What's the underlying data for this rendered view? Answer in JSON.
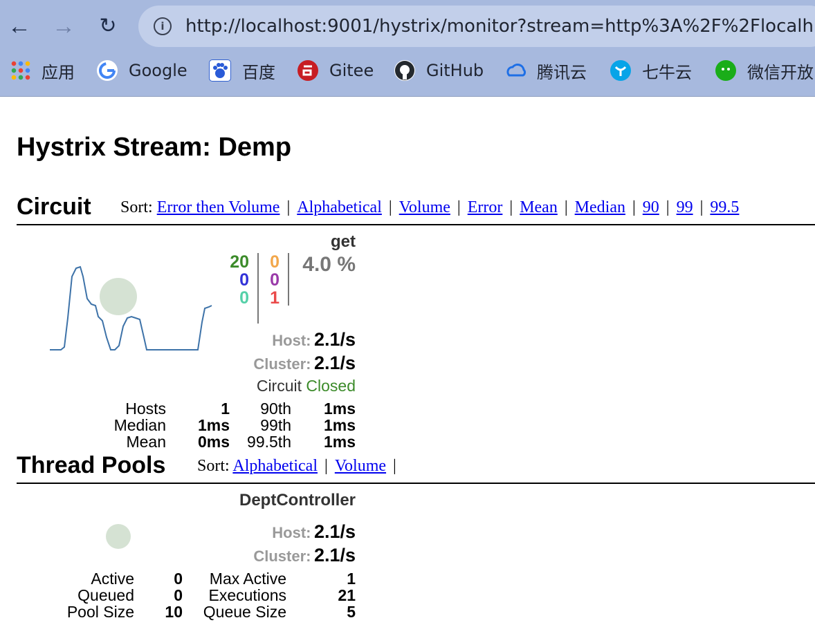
{
  "browser": {
    "url": "http://localhost:9001/hystrix/monitor?stream=http%3A%2F%2Flocalh",
    "bookmarks": [
      {
        "label": "应用",
        "icon": "apps-grid-icon"
      },
      {
        "label": "Google",
        "icon": "google-icon"
      },
      {
        "label": "百度",
        "icon": "baidu-icon"
      },
      {
        "label": "Gitee",
        "icon": "gitee-icon"
      },
      {
        "label": "GitHub",
        "icon": "github-icon"
      },
      {
        "label": "腾讯云",
        "icon": "tencent-cloud-icon"
      },
      {
        "label": "七牛云",
        "icon": "qiniu-icon"
      },
      {
        "label": "微信开放",
        "icon": "wechat-icon"
      }
    ]
  },
  "page": {
    "title": "Hystrix Stream: Demp"
  },
  "circuit": {
    "section_title": "Circuit",
    "sort_label": "Sort:",
    "sort_links": [
      "Error then Volume",
      "Alphabetical",
      "Volume",
      "Error",
      "Mean",
      "Median",
      "90",
      "99",
      "99.5"
    ],
    "name": "get",
    "counts": {
      "success": "20",
      "short_circuited": "0",
      "bad_request": "0",
      "timeout": "0",
      "rejected": "0",
      "failure": "1"
    },
    "error_pct": "4.0 %",
    "host_label": "Host:",
    "host_rate": "2.1/s",
    "cluster_label": "Cluster:",
    "cluster_rate": "2.1/s",
    "circuit_label": "Circuit",
    "circuit_status": "Closed",
    "stats": {
      "hosts_label": "Hosts",
      "hosts": "1",
      "median_label": "Median",
      "median": "1ms",
      "mean_label": "Mean",
      "mean": "0ms",
      "p90_label": "90th",
      "p90": "1ms",
      "p99_label": "99th",
      "p99": "1ms",
      "p995_label": "99.5th",
      "p995": "1ms"
    },
    "colors": {
      "success": "#3c8b2a",
      "short_circuited": "#3232d8",
      "bad_request": "#55d0a8",
      "timeout": "#f2a74b",
      "rejected": "#9a3aa9",
      "failure": "#ea4a4a",
      "closed": "#3c8b2a",
      "sparkline": "#3d72a8",
      "bubble": "#d5e2d3"
    }
  },
  "thread_pools": {
    "section_title": "Thread Pools",
    "sort_label": "Sort:",
    "sort_links": [
      "Alphabetical",
      "Volume"
    ],
    "name": "DeptController",
    "host_label": "Host:",
    "host_rate": "2.1/s",
    "cluster_label": "Cluster:",
    "cluster_rate": "2.1/s",
    "stats": {
      "active_label": "Active",
      "active": "0",
      "queued_label": "Queued",
      "queued": "0",
      "pool_size_label": "Pool Size",
      "pool_size": "10",
      "max_active_label": "Max Active",
      "max_active": "1",
      "executions_label": "Executions",
      "executions": "21",
      "queue_size_label": "Queue Size",
      "queue_size": "5"
    }
  }
}
